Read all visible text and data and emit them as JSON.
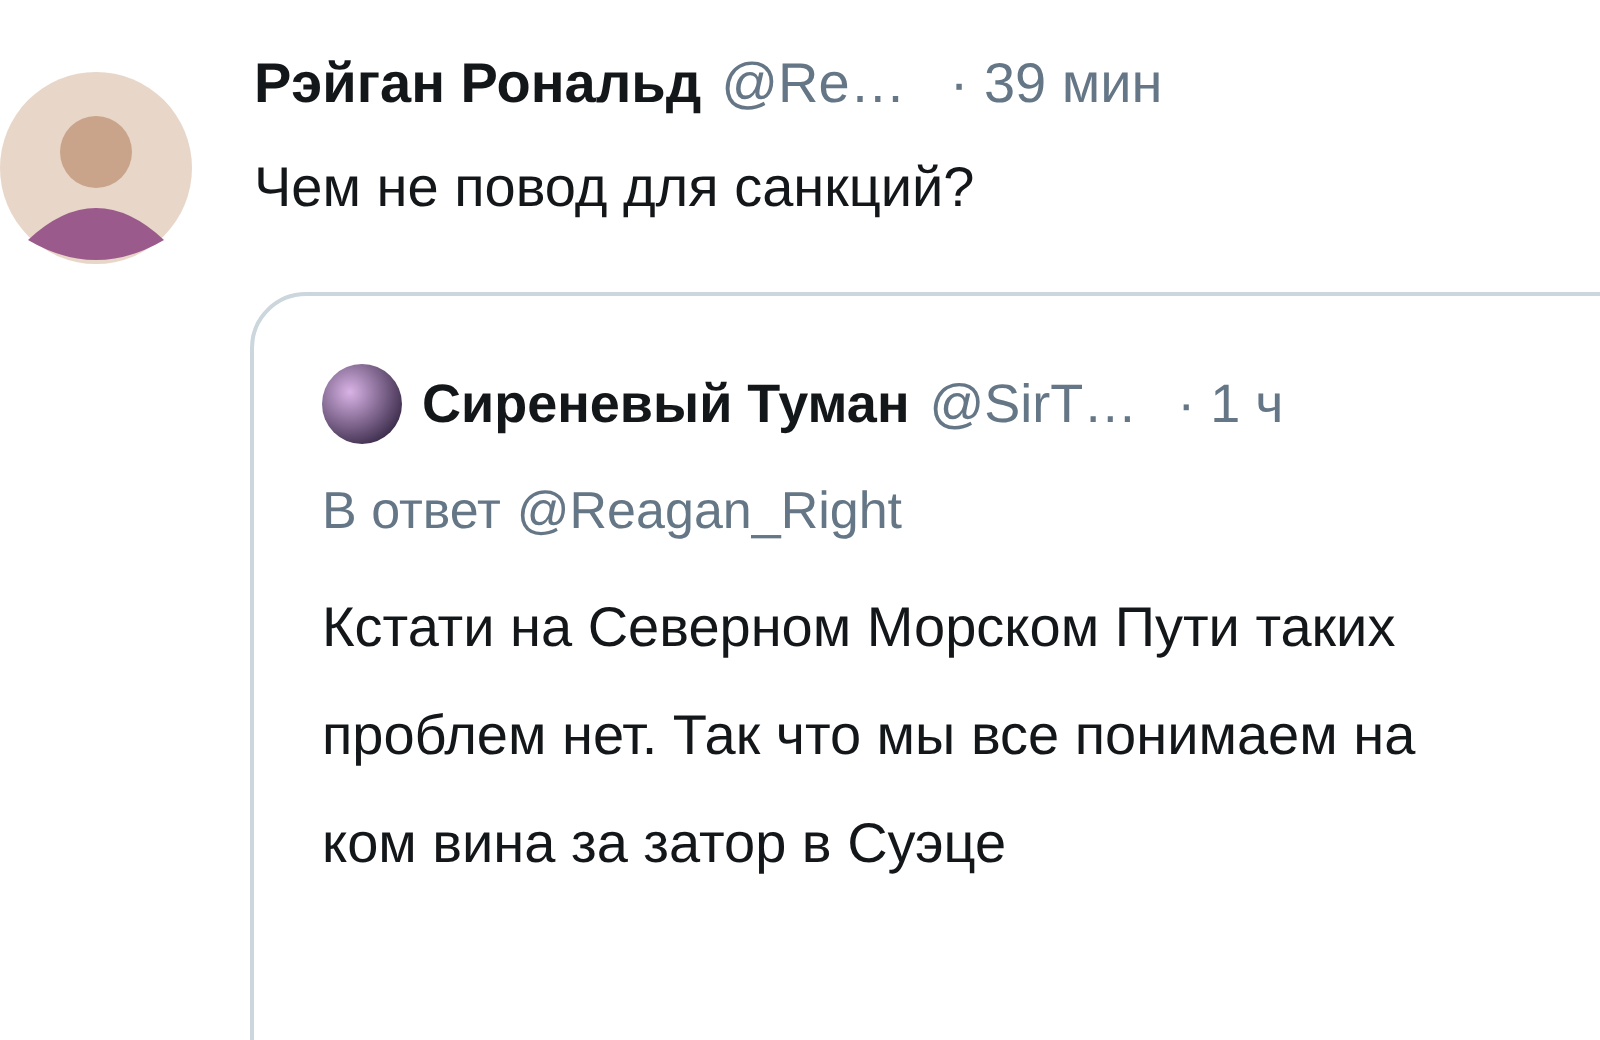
{
  "tweet": {
    "author": "Рэйган Рональд",
    "handle": "@Re…",
    "time": "· 39 мин",
    "text": "Чем не повод для санкций?",
    "quote": {
      "author": "Сиреневый Туман",
      "handle": "@SirT…",
      "time": "· 1 ч",
      "reply_to_label": "В ответ",
      "reply_to": "@Reagan_Right",
      "text": "Кстати на Северном Морском Пути таких проблем нет. Так что мы все понимаем на ком вина за затор в Суэце"
    }
  }
}
